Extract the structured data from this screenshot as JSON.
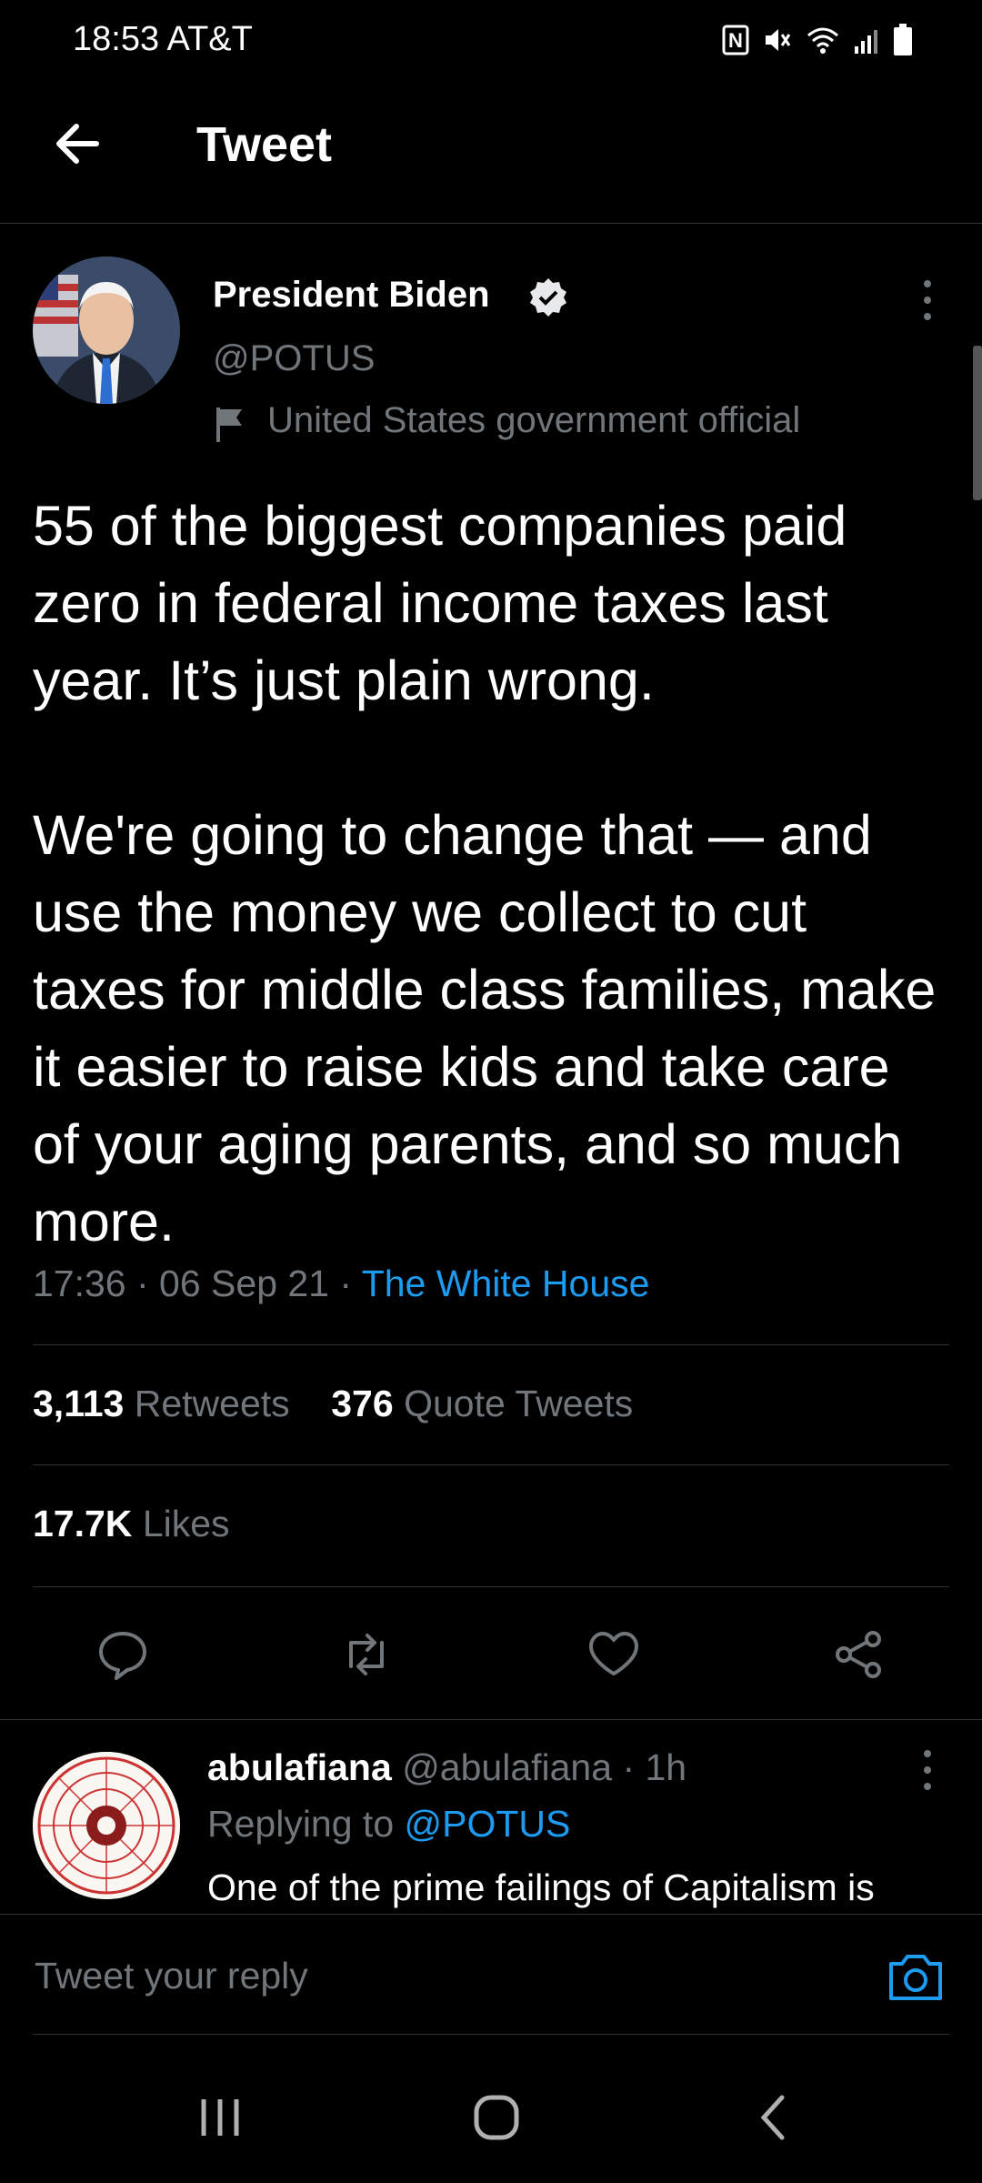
{
  "status_bar": {
    "time": "18:53",
    "carrier": "AT&T",
    "time_carrier": "18:53 AT&T"
  },
  "header": {
    "title": "Tweet"
  },
  "tweet": {
    "author_name": "President Biden",
    "author_handle": "@POTUS",
    "gov_label": "United States government official",
    "text": "55 of the biggest companies paid zero in federal income taxes last year. It’s just plain wrong.\n\nWe're going to change that — and use the money we collect to cut taxes for middle class families, make it easier to raise kids and take care of your aging parents, and so much more.",
    "time": "17:36",
    "date": "06 Sep 21",
    "source": "The White House",
    "retweets_count": "3,113",
    "retweets_label": "Retweets",
    "quotes_count": "376",
    "quotes_label": "Quote Tweets",
    "likes_count": "17.7K",
    "likes_label": "Likes"
  },
  "reply": {
    "name": "abulafiana",
    "handle": "@abulafiana",
    "age": "1h",
    "replying_prefix": "Replying to",
    "replying_handle": "@POTUS",
    "text": "One of the prime failings of Capitalism is"
  },
  "composer": {
    "placeholder": "Tweet your reply"
  },
  "icons": {
    "verified": "verified-badge-icon",
    "gov": "flag-icon",
    "reply": "comment-icon",
    "retweet": "retweet-icon",
    "like": "heart-icon",
    "share": "share-icon",
    "camera": "camera-icon"
  },
  "colors": {
    "background": "#000000",
    "link": "#1d9bf0",
    "muted": "#71767b",
    "divider": "#2f3336"
  }
}
